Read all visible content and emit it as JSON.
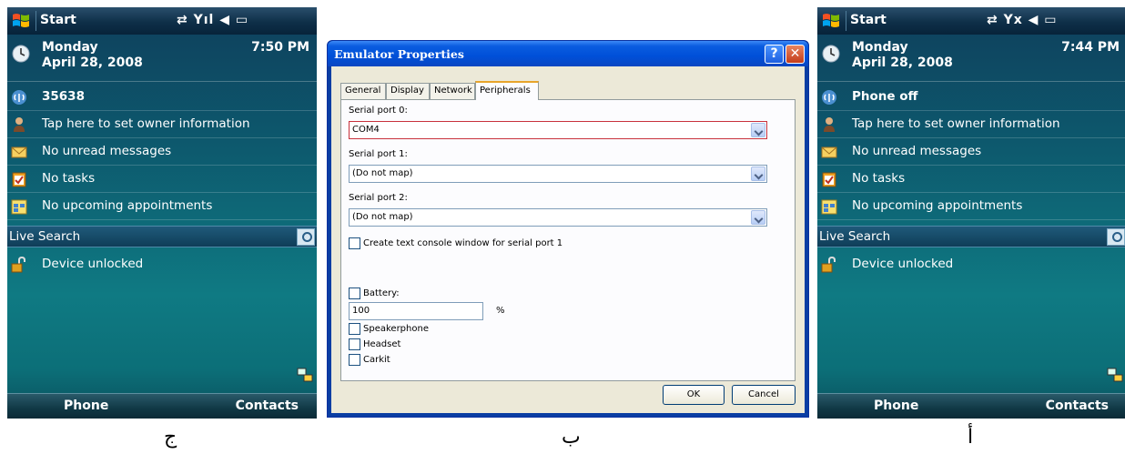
{
  "captions": {
    "left": "ج",
    "middle": "ب",
    "right": "أ"
  },
  "phone_left": {
    "start_label": "Start",
    "status_icons": "⇄ Yıl ◀ ▭",
    "day": "Monday",
    "date": "April 28, 2008",
    "time": "7:50 PM",
    "phone_status": "35638",
    "owner_info": "Tap here to set owner information",
    "messages": "No unread messages",
    "tasks": "No tasks",
    "appointments": "No upcoming appointments",
    "search_label": "Live Search",
    "lock_status": "Device unlocked",
    "softkey_left": "Phone",
    "softkey_right": "Contacts"
  },
  "phone_right": {
    "start_label": "Start",
    "status_icons": "⇄ Yx ◀ ▭",
    "day": "Monday",
    "date": "April 28, 2008",
    "time": "7:44 PM",
    "phone_status": "Phone off",
    "owner_info": "Tap here to set owner information",
    "messages": "No unread messages",
    "tasks": "No tasks",
    "appointments": "No upcoming appointments",
    "search_label": "Live Search",
    "lock_status": "Device unlocked",
    "softkey_left": "Phone",
    "softkey_right": "Contacts"
  },
  "dialog": {
    "title": "Emulator Properties",
    "help_glyph": "?",
    "close_glyph": "✕",
    "tabs": [
      "General",
      "Display",
      "Network",
      "Peripherals"
    ],
    "active_tab": "Peripherals",
    "serial0_label": "Serial port 0:",
    "serial0_value": "COM4",
    "serial1_label": "Serial port 1:",
    "serial1_value": "(Do not map)",
    "serial2_label": "Serial port 2:",
    "serial2_value": "(Do not map)",
    "console_checkbox": "Create text console window for serial port 1",
    "battery_label": "Battery:",
    "battery_value": "100",
    "battery_unit": "%",
    "speakerphone": "Speakerphone",
    "headset": "Headset",
    "carkit": "Carkit",
    "ok": "OK",
    "cancel": "Cancel"
  }
}
